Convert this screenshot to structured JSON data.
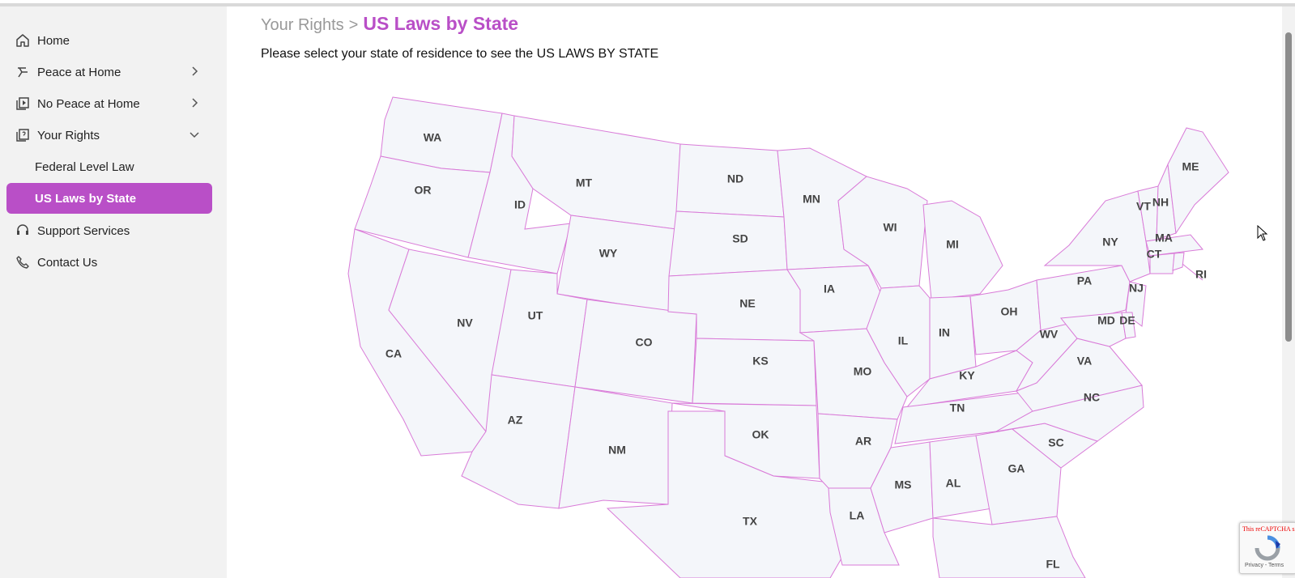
{
  "sidebar": {
    "items": [
      {
        "label": "Home",
        "icon": "home-icon"
      },
      {
        "label": "Peace at Home",
        "icon": "peace-icon"
      },
      {
        "label": "No Peace at Home",
        "icon": "play-book-icon"
      },
      {
        "label": "Your Rights",
        "icon": "help-book-icon"
      },
      {
        "label": "Federal Level Law"
      },
      {
        "label": "US Laws by State"
      },
      {
        "label": "Support Services",
        "icon": "headset-icon"
      },
      {
        "label": "Contact Us",
        "icon": "phone-icon"
      }
    ]
  },
  "breadcrumb": {
    "parent": "Your Rights",
    "separator": ">",
    "current": "US Laws by State"
  },
  "instruction": "Please select your state of residence to see the US LAWS BY STATE",
  "map": {
    "states": [
      "WA",
      "OR",
      "CA",
      "ID",
      "NV",
      "MT",
      "WY",
      "UT",
      "AZ",
      "CO",
      "NM",
      "ND",
      "SD",
      "NE",
      "KS",
      "OK",
      "TX",
      "MN",
      "IA",
      "MO",
      "AR",
      "LA",
      "WI",
      "IL",
      "MI",
      "IN",
      "KY",
      "TN",
      "MS",
      "AL",
      "OH",
      "WV",
      "VA",
      "NC",
      "SC",
      "GA",
      "FL",
      "PA",
      "NY",
      "NJ",
      "MD",
      "DE",
      "VT",
      "NH",
      "ME",
      "MA",
      "CT",
      "RI"
    ]
  },
  "recaptcha": {
    "warning": "This reCAPTCHA site may not...",
    "links": "Privacy - Terms"
  },
  "colors": {
    "accent": "#b94fc7",
    "state_fill": "#f4f6fa",
    "state_border": "#d97bd8",
    "sidebar_bg": "#f2f2f2"
  }
}
